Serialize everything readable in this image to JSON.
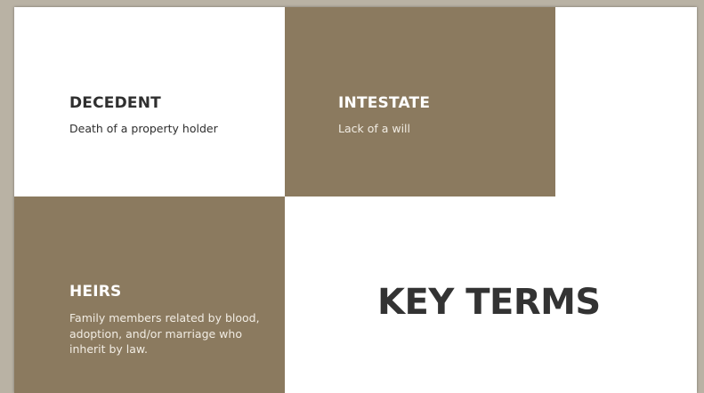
{
  "colors": {
    "accent": "#8b7a5f",
    "slide_background": "#ffffff",
    "dark_text": "#2f2f2f",
    "light_text": "#ffffff"
  },
  "slide": {
    "title": "KEY TERMS",
    "terms": [
      {
        "term": "DECEDENT",
        "definition": "Death of a property holder"
      },
      {
        "term": "INTESTATE",
        "definition": "Lack of a will"
      },
      {
        "term": "HEIRS",
        "definition": "Family members related by blood, adoption, and/or marriage who inherit by law."
      }
    ]
  }
}
